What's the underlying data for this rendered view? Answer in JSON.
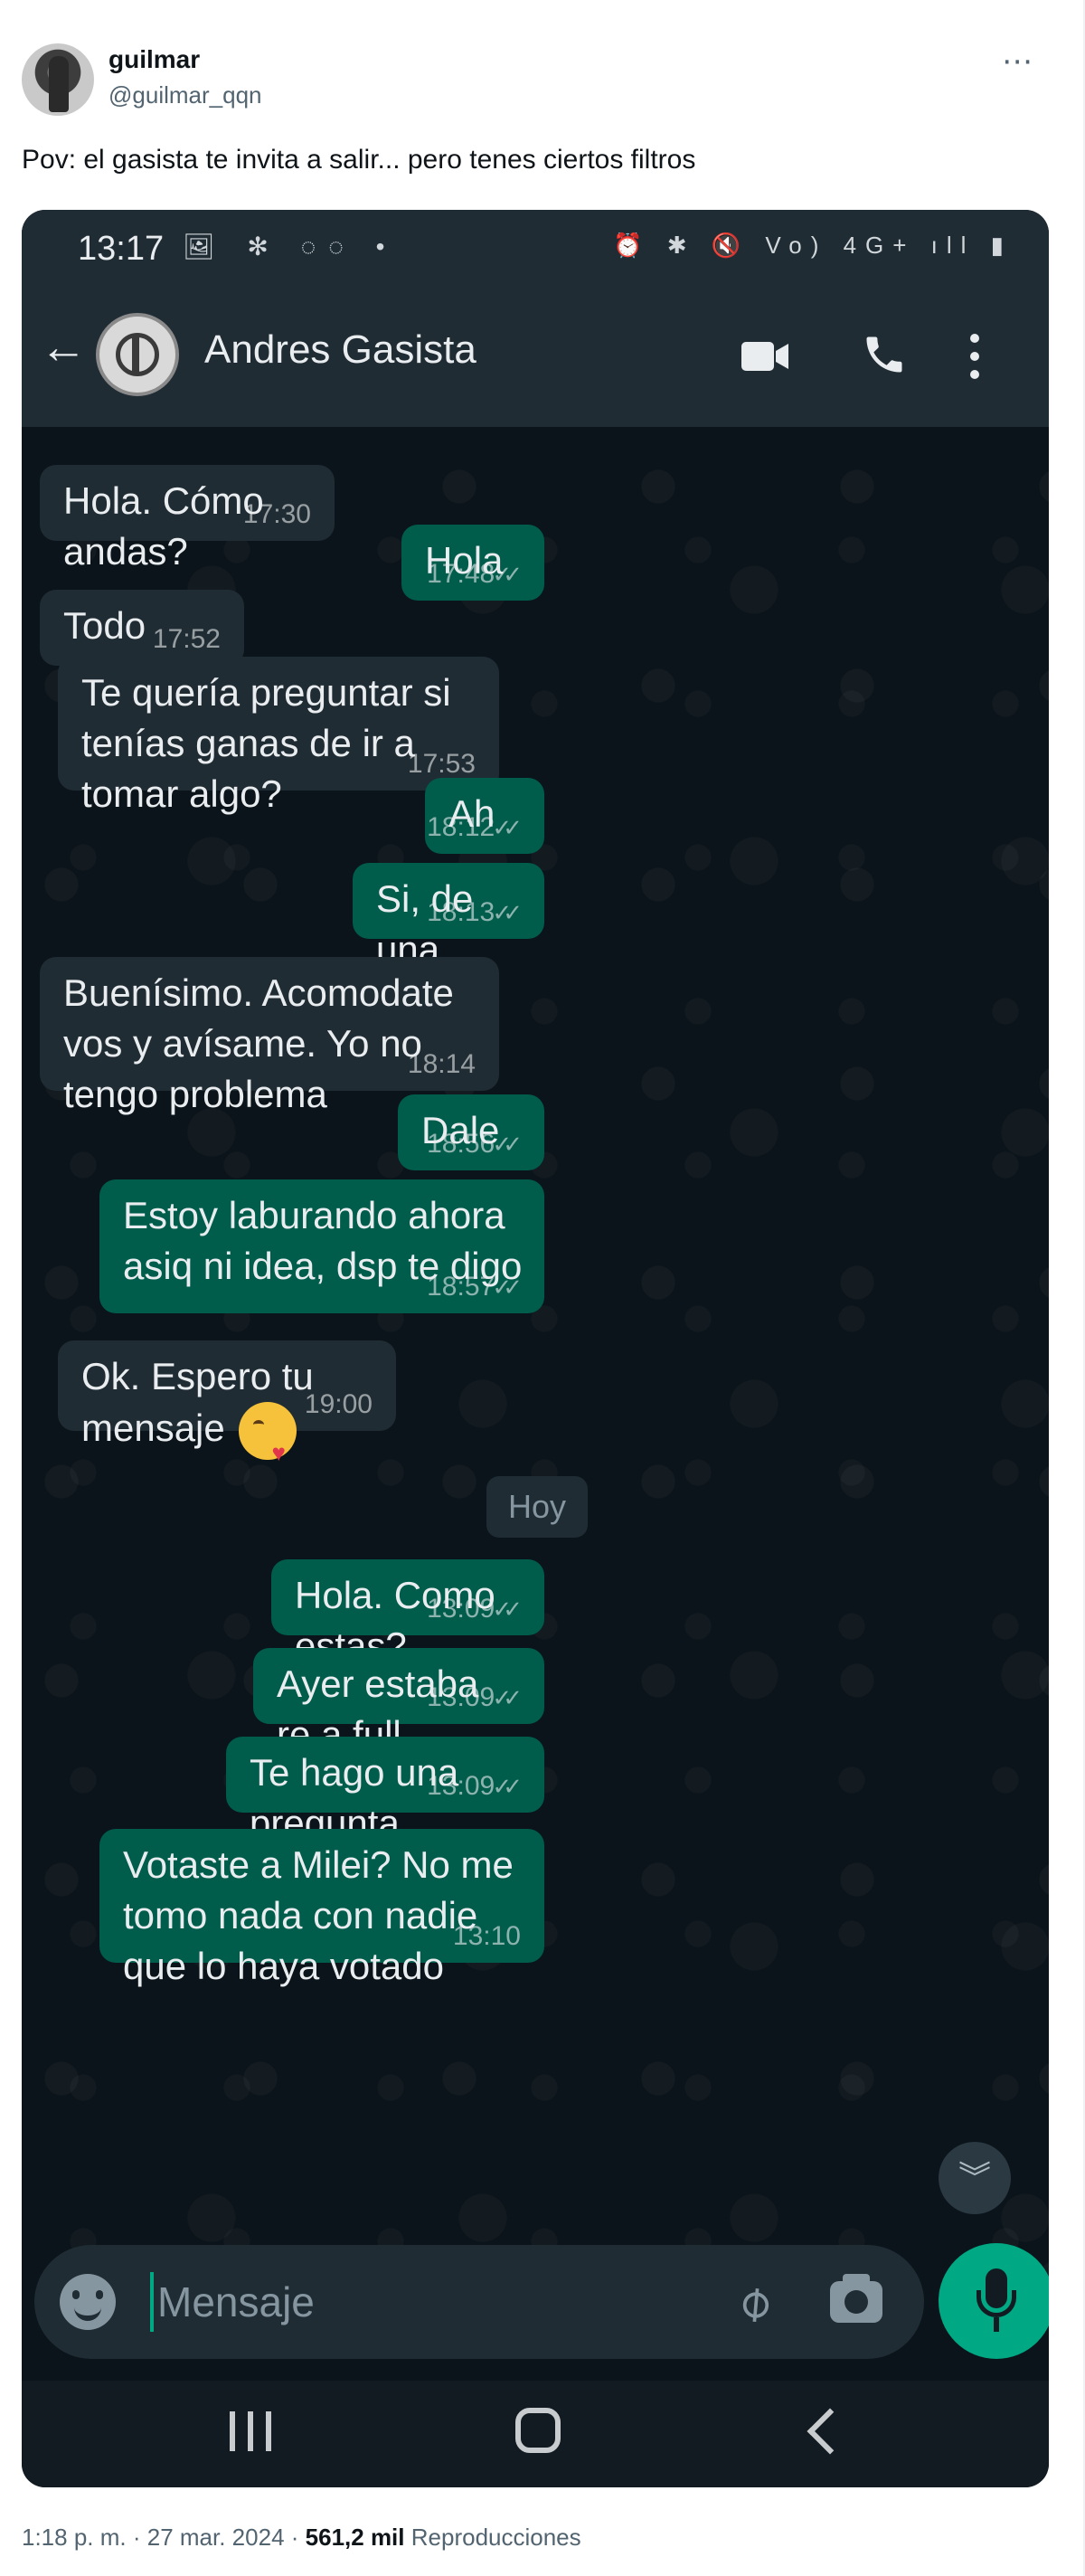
{
  "tweet": {
    "author_name": "guilmar",
    "author_handle": "@guilmar_qqn",
    "text": "Pov: el gasista te invita a salir... pero tenes ciertos filtros",
    "more_icon": "more-horizontal-icon",
    "footer": {
      "time": "1:18 p. m.",
      "date": "27 mar. 2024",
      "views": "561,2 mil",
      "views_label": "Reproducciones"
    }
  },
  "status_bar": {
    "time": "13:17",
    "left_icons": "🖼 ✻ ◌◌ •",
    "right_icons": "⏰ ✱ 🔇 Vo) 4G+ ıll ▮"
  },
  "chat": {
    "contact_name": "Andres Gasista",
    "day_separator": "Hoy",
    "messages": [
      {
        "dir": "in",
        "text": "Hola. Cómo andas?",
        "time": "17:30"
      },
      {
        "dir": "out",
        "text": "Hola",
        "time": "17:48"
      },
      {
        "dir": "in",
        "text": "Todo bien?",
        "time": "17:52"
      },
      {
        "dir": "in",
        "text": "Te quería preguntar si tenías ganas de ir a tomar algo?",
        "time": "17:53"
      },
      {
        "dir": "out",
        "text": "Ah",
        "time": "18:12"
      },
      {
        "dir": "out",
        "text": "Si, de una",
        "time": "18:13"
      },
      {
        "dir": "in",
        "text": "Buenísimo. Acomodate vos y avísame. Yo no tengo problema",
        "time": "18:14"
      },
      {
        "dir": "out",
        "text": "Dale",
        "time": "18:56"
      },
      {
        "dir": "out",
        "text": "Estoy laburando ahora asiq ni idea, dsp te digo",
        "time": "18:57"
      },
      {
        "dir": "in",
        "text": "Ok. Espero tu mensaje",
        "time": "19:00"
      },
      {
        "dir": "out",
        "text": "Hola. Como estas?",
        "time": "13:09"
      },
      {
        "dir": "out",
        "text": "Ayer estaba re a full",
        "time": "13:09"
      },
      {
        "dir": "out",
        "text": "Te hago una pregunta",
        "time": "13:09"
      },
      {
        "dir": "out",
        "text": "Votaste a Milei? No me tomo nada con nadie que lo haya votado",
        "time": "13:10"
      }
    ]
  },
  "composer": {
    "placeholder": "Mensaje"
  },
  "colors": {
    "incoming_bubble": "#202c33",
    "outgoing_bubble": "#005c4b",
    "accent": "#00a884",
    "chat_background": "#0b141a",
    "header": "#1f2c34"
  }
}
